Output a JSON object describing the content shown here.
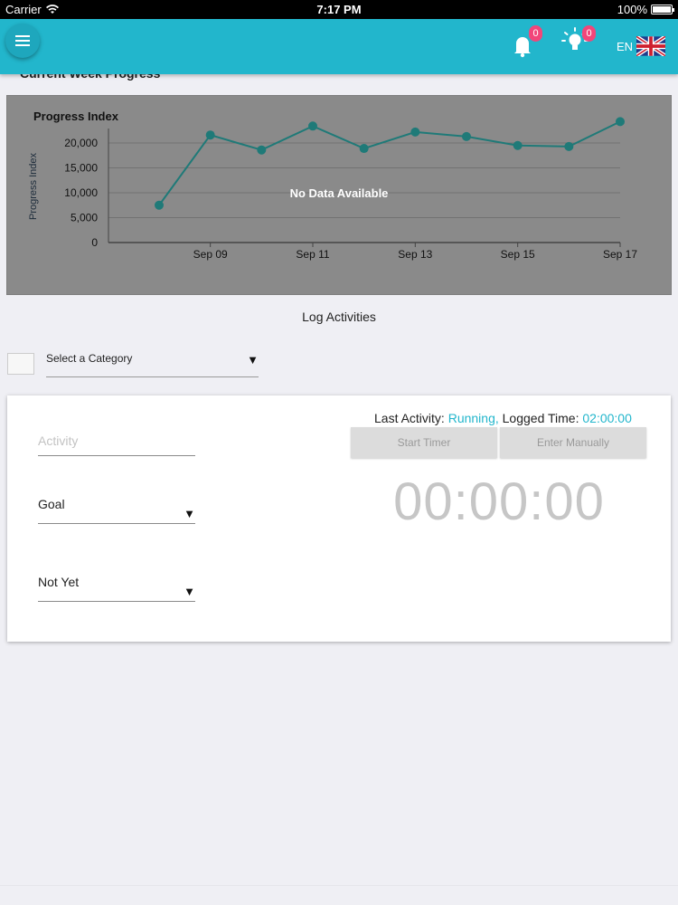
{
  "status_bar": {
    "carrier": "Carrier",
    "time": "7:17 PM",
    "battery": "100%"
  },
  "header": {
    "notification_count": "0",
    "tips_count": "0",
    "language": "EN"
  },
  "section_title": "Current Week Progress",
  "chart_data": {
    "type": "line",
    "title": "Progress Index",
    "ylabel": "Progress Index",
    "xlabel": "",
    "overlay_text": "No Data Available",
    "x_ticks": [
      "Sep 09",
      "Sep 11",
      "Sep 13",
      "Sep 15",
      "Sep 17"
    ],
    "y_ticks": [
      "0",
      "5,000",
      "10,000",
      "15,000",
      "20,000"
    ],
    "ylim": [
      0,
      24000
    ],
    "x": [
      "Sep 08",
      "Sep 09",
      "Sep 10",
      "Sep 11",
      "Sep 12",
      "Sep 13",
      "Sep 14",
      "Sep 15",
      "Sep 16",
      "Sep 17"
    ],
    "values": [
      7500,
      21600,
      18600,
      23400,
      18900,
      22200,
      21300,
      19500,
      19300,
      24300
    ],
    "line_color": "#1f7a78",
    "grid": true
  },
  "log": {
    "title": "Log Activities",
    "category_placeholder": "Select a Category"
  },
  "activity_card": {
    "activity_placeholder": "Activity",
    "goal_label": "Goal",
    "status_label": "Not Yet",
    "last_activity_prefix": "Last Activity: ",
    "last_activity_value": "Running,",
    "logged_time_prefix": " Logged Time: ",
    "logged_time_value": "02:00:00",
    "start_timer_label": "Start Timer",
    "enter_manually_label": "Enter Manually",
    "timer_display": "00:00:00"
  },
  "colors": {
    "accent": "#22b6cc",
    "badge": "#f2467a"
  }
}
